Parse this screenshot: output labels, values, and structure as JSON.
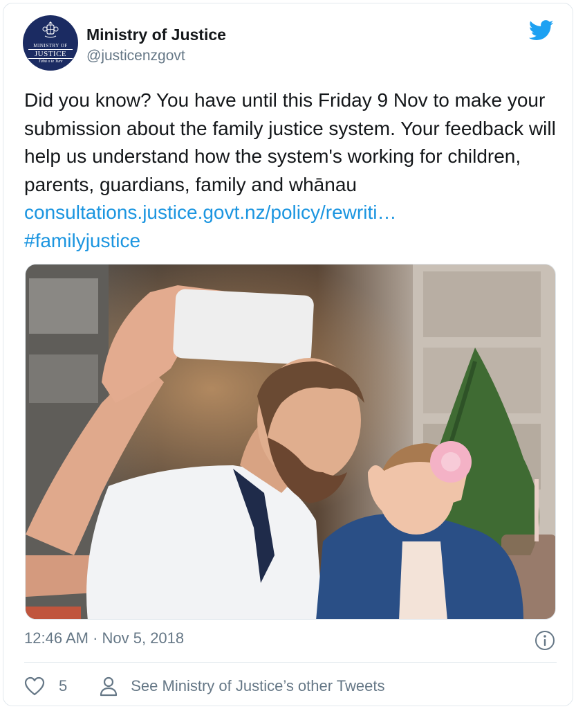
{
  "account": {
    "name": "Ministry of Justice",
    "handle": "@justicenzgovt",
    "avatar": {
      "line1": "MINISTRY OF",
      "line2": "JUSTICE",
      "line3": "Tāhū o te Ture"
    }
  },
  "tweet": {
    "text_before": "Did you know? You have until this Friday 9 Nov to make your submission about the family justice system. Your feedback will help us understand how the system's working for children, parents, guardians, family and whānau ",
    "link": "consultations.justice.govt.nz/policy/rewriti…",
    "hashtag": "#familyjustice"
  },
  "media": {
    "description_icon": "photo"
  },
  "meta": {
    "timestamp": "12:46 AM · Nov 5, 2018"
  },
  "actions": {
    "like_count": "5",
    "see_more": "See Ministry of Justice’s other Tweets"
  },
  "colors": {
    "link": "#1b95e0",
    "twitter_blue": "#1da1f2",
    "secondary_text": "#657786",
    "border": "#e1e8ed",
    "avatar_bg": "#1b2b62"
  },
  "icons": {
    "brand": "twitter-bird-icon",
    "info": "info-icon",
    "like": "heart-icon",
    "profile": "person-icon"
  }
}
